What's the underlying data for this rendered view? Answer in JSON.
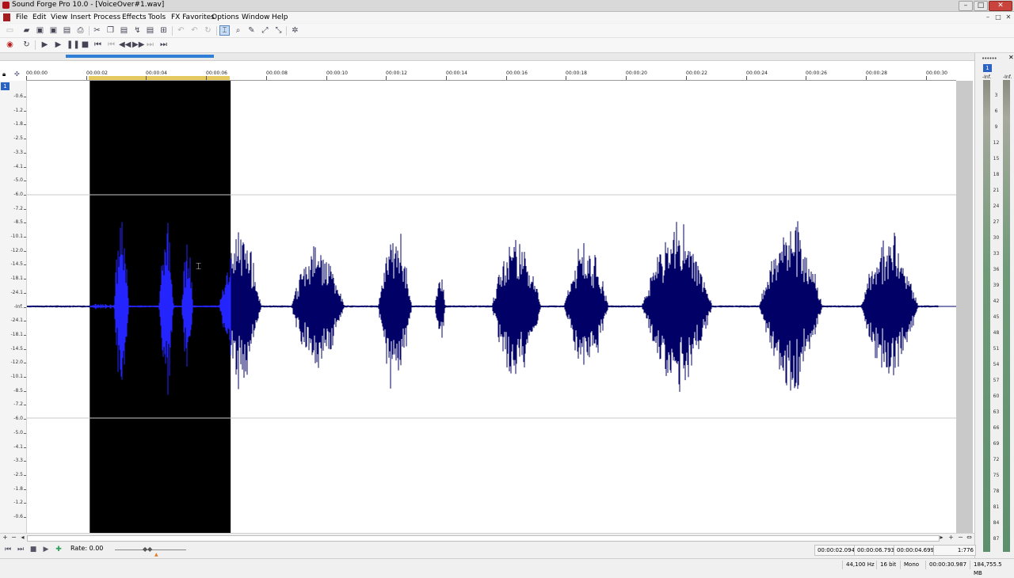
{
  "window": {
    "title": "Sound Forge Pro 10.0 - [VoiceOver#1.wav]",
    "min_glyph": "–",
    "max_glyph": "□",
    "close_glyph": "✕"
  },
  "menu": {
    "items": [
      "File",
      "Edit",
      "View",
      "Insert",
      "Process",
      "Effects",
      "Tools",
      "FX Favorites",
      "Options",
      "Window",
      "Help"
    ],
    "mdi": [
      "–",
      "□",
      "✕"
    ]
  },
  "toolbar1": {
    "icons": [
      "new-icon",
      "open-icon",
      "save-icon",
      "save-as-icon",
      "render-icon",
      "print-icon",
      "cut-icon",
      "copy-icon",
      "paste-icon",
      "paste-special-icon",
      "mix-icon",
      "crop-icon",
      "trim-icon",
      "undo-icon",
      "redo-icon",
      "repeat-icon",
      "edit-tool-icon",
      "magnify-tool-icon",
      "pencil-tool-icon",
      "envelope-tool-icon",
      "event-tool-icon",
      "auto-snap-icon"
    ]
  },
  "toolbar2": {
    "icons": [
      "record-icon",
      "loop-icon",
      "play-all-icon",
      "play-icon",
      "pause-icon",
      "stop-icon",
      "go-to-start-icon",
      "previous-marker-icon",
      "rewind-icon",
      "forward-icon",
      "next-marker-icon",
      "go-to-end-icon"
    ]
  },
  "overview": {
    "visible_fraction": 0.152
  },
  "ruler": {
    "labels": [
      "00:00:00",
      "00:00:02",
      "00:00:04",
      "00:00:06",
      "00:00:08",
      "00:00:10",
      "00:00:12",
      "00:00:14",
      "00:00:16",
      "00:00:18",
      "00:00:20",
      "00:00:22",
      "00:00:24",
      "00:00:26",
      "00:00:28",
      "00:00:30"
    ]
  },
  "amplitude_scale": {
    "labels": [
      "-0.6",
      "-1.2",
      "-1.8",
      "-2.5",
      "-3.3",
      "-4.1",
      "-5.0",
      "-6.0",
      "-7.2",
      "-8.5",
      "-10.1",
      "-12.0",
      "-14.5",
      "-18.1",
      "-24.1",
      "-Inf.",
      "-24.1",
      "-18.1",
      "-14.5",
      "-12.0",
      "-10.1",
      "-8.5",
      "-7.2",
      "-6.0",
      "-5.0",
      "-4.1",
      "-3.3",
      "-2.5",
      "-1.8",
      "-1.2",
      "-0.6"
    ]
  },
  "channel": {
    "number": "1"
  },
  "waveform": {
    "color": "#000066",
    "selected_color": "#2424ff",
    "selection_background": "#000000",
    "guide_color": "#c8c8c8",
    "total_seconds": 30.987,
    "selection_start_s": 2.094,
    "selection_end_s": 6.793
  },
  "meters": {
    "channel_badge": "1",
    "dots": "••••••",
    "close": "✕",
    "left_top": "-Inf.",
    "right_top": "-Inf.",
    "scale": [
      "3",
      "6",
      "9",
      "12",
      "15",
      "18",
      "21",
      "24",
      "27",
      "30",
      "33",
      "36",
      "39",
      "42",
      "45",
      "48",
      "51",
      "54",
      "57",
      "60",
      "63",
      "66",
      "69",
      "72",
      "75",
      "78",
      "81",
      "84",
      "87"
    ]
  },
  "transport": {
    "rate_label": "Rate: 0.00"
  },
  "selection": {
    "start": "00:00:02.094",
    "end": "00:00:06.793",
    "length": "00:00:04.699",
    "zoom": "1:776"
  },
  "status": {
    "sample_rate": "44,100 Hz",
    "bit_depth": "16 bit",
    "channels": "Mono",
    "length": "00:00:30.987",
    "disk_space": "184,755.5 MB"
  }
}
